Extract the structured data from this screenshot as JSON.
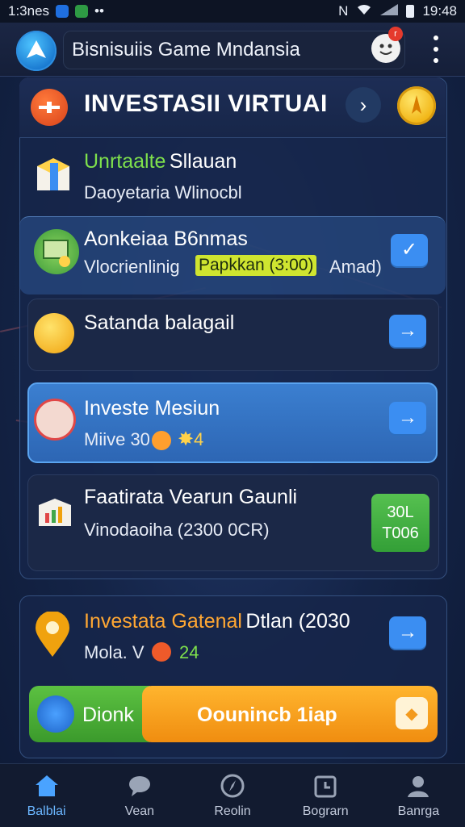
{
  "status_bar": {
    "time_left": "1:3nes",
    "time_right": "19:48"
  },
  "app_bar": {
    "search_text": "Bisnisuiis Game Mndansia",
    "notification_count": "r"
  },
  "header": {
    "title": "INVESTASII VIRTUAI",
    "next_symbol": "›"
  },
  "items": [
    {
      "title": "Unrtaalte",
      "title_rest": "Sllauan",
      "subtitle": "Daoyetaria Wlinocbl"
    },
    {
      "title": "Aonkeiaa B6nmas",
      "subtitle": "Vlocrienlinig",
      "tag": "Papkkan (3:00)",
      "extra": "Amad)"
    },
    {
      "title": "Satanda balagail"
    },
    {
      "title": "Investe Mesiun",
      "subtitle": "Miive 30",
      "value": "4"
    },
    {
      "title": "Faatirata Vearun Gaunli",
      "subtitle": "Vinodaoiha (2300 0CR)",
      "button_line1": "30L",
      "button_line2": "T006"
    }
  ],
  "panel2": {
    "title": "Investata Gatenal",
    "title_rest": "Dtlan (2030",
    "subtitle": "Mola. V",
    "value": "24",
    "left_button": "Dionk",
    "right_button": "Oounincb 1iap"
  },
  "bottom_nav": [
    {
      "label": "Balblai",
      "icon": "home-icon",
      "active": true
    },
    {
      "label": "Vean",
      "icon": "chat-icon",
      "active": false
    },
    {
      "label": "Reolin",
      "icon": "compass-icon",
      "active": false
    },
    {
      "label": "Bograrn",
      "icon": "calendar-icon",
      "active": false
    },
    {
      "label": "Banrga",
      "icon": "profile-icon",
      "active": false
    }
  ],
  "colors": {
    "accent_blue": "#3b8ef2",
    "accent_orange": "#ffa733",
    "accent_green": "#7ee04c"
  }
}
